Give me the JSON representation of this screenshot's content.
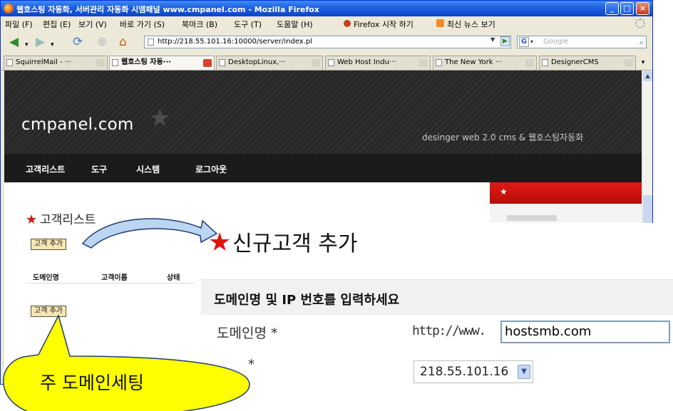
{
  "window": {
    "title": "웹호스팅 자동화, 서버관리 자동화 시엠패널 www.cmpanel.com - Mozilla Firefox",
    "minimize": "_",
    "maximize": "□",
    "close": "×"
  },
  "menubar": {
    "items": [
      "파일 (F)",
      "편집 (E)",
      "보기 (V)",
      "바로 가기 (S)",
      "북마크 (B)",
      "도구 (T)",
      "도움말 (H)",
      "Firefox 시작 하기",
      "최신 뉴스 보기"
    ]
  },
  "navbar": {
    "back_icon": "back-arrow-icon",
    "url": "http://218.55.101.16:10000/server/index.pl",
    "search_placeholder": "Google"
  },
  "tabs": [
    {
      "label": "SquirrelMail - ···"
    },
    {
      "label": "웹호스팅 자동···"
    },
    {
      "label": "DesktopLinux,···"
    },
    {
      "label": "Web Host Indu···"
    },
    {
      "label": "The New York ···"
    },
    {
      "label": "DesignerCMS"
    }
  ],
  "site": {
    "brand": "cmpanel.com",
    "tagline": "desinger web 2.0 cms & 웹호스팅자동화",
    "nav": [
      "고객리스트",
      "도구",
      "시스템",
      "로그아웃"
    ],
    "section_title": "고객리스트",
    "add_button": "고객 추가",
    "columns": [
      "도메인명",
      "고객이름",
      "상태"
    ],
    "sidebar_star": "★"
  },
  "overlay": {
    "title": "신규고객 추가",
    "band_text": "도메인명 및 IP 번호를 입력하세요",
    "domain_label": "도메인명 *",
    "url_prefix": "http://www.",
    "domain_value": "hostsmb.com",
    "ip_label_star": "*",
    "ip_value": "218.55.101.16"
  },
  "callout": {
    "text": "주 도메인세팅"
  },
  "colors": {
    "accent_red": "#d21812",
    "titlebar_blue": "#1f5fe0",
    "banner_dark": "#2f2f2f",
    "nav_dark": "#1b1b1b",
    "callout_yellow": "#ffff00",
    "arrow_blue": "#a9c8ee"
  }
}
